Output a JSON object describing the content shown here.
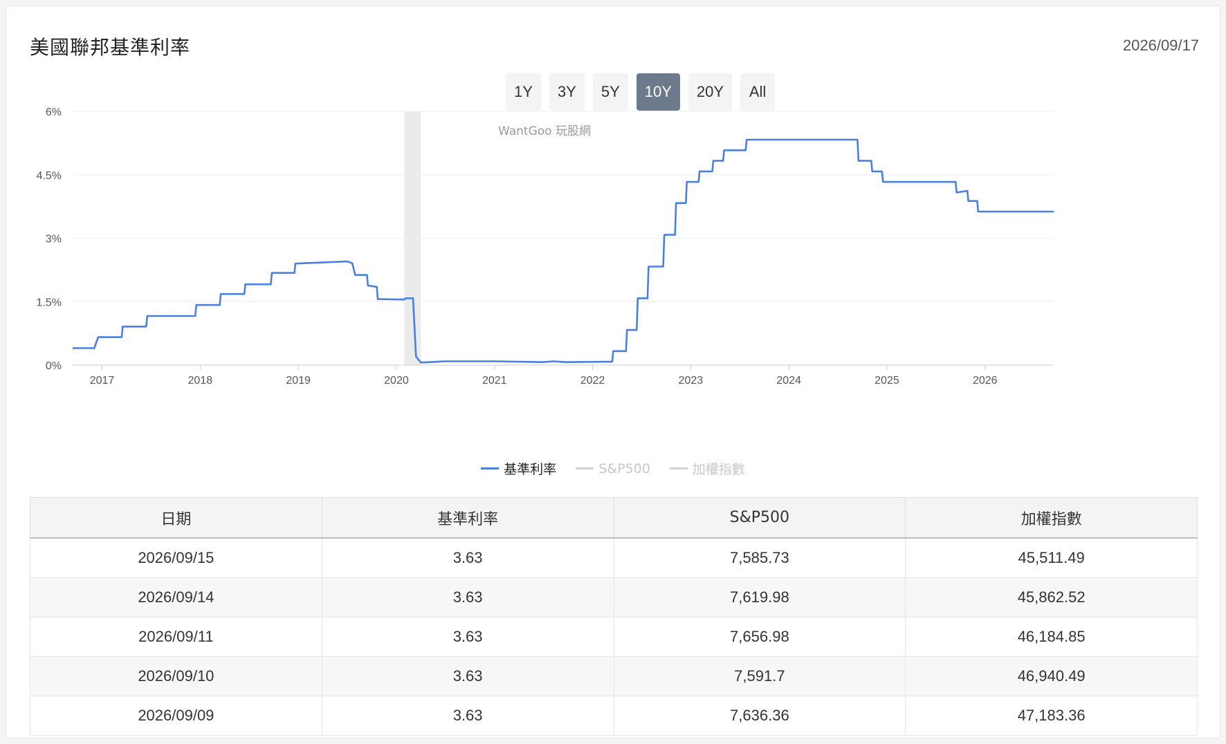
{
  "header": {
    "title": "美國聯邦基準利率",
    "date": "2026/09/17"
  },
  "range_buttons": [
    {
      "label": "1Y",
      "active": false
    },
    {
      "label": "3Y",
      "active": false
    },
    {
      "label": "5Y",
      "active": false
    },
    {
      "label": "10Y",
      "active": true
    },
    {
      "label": "20Y",
      "active": false
    },
    {
      "label": "All",
      "active": false
    }
  ],
  "colors": {
    "series": "#4a7fe0",
    "recession_band": "#ebebeb",
    "gridline": "#eeeeee",
    "legend_off": "#cccccc",
    "active_button": "#6c7a8c"
  },
  "chart_data": {
    "type": "line",
    "watermark": "WantGoo 玩股網",
    "y_ticks": [
      "0%",
      "1.5%",
      "3%",
      "4.5%",
      "6%"
    ],
    "ylim": [
      0,
      6
    ],
    "x_ticks": [
      "2017",
      "2018",
      "2019",
      "2020",
      "2021",
      "2022",
      "2023",
      "2024",
      "2025",
      "2026"
    ],
    "xlim": [
      2016.7,
      2026.7
    ],
    "recession_band": [
      2020.08,
      2020.25
    ],
    "legend": [
      {
        "name": "基準利率",
        "visible": true
      },
      {
        "name": "S&P500",
        "visible": false
      },
      {
        "name": "加權指數",
        "visible": false
      }
    ],
    "series": [
      {
        "name": "基準利率",
        "points": [
          [
            2016.7,
            0.4
          ],
          [
            2016.92,
            0.4
          ],
          [
            2016.96,
            0.66
          ],
          [
            2017.2,
            0.66
          ],
          [
            2017.21,
            0.91
          ],
          [
            2017.45,
            0.91
          ],
          [
            2017.46,
            1.16
          ],
          [
            2017.95,
            1.16
          ],
          [
            2017.96,
            1.42
          ],
          [
            2018.2,
            1.42
          ],
          [
            2018.21,
            1.68
          ],
          [
            2018.45,
            1.68
          ],
          [
            2018.46,
            1.91
          ],
          [
            2018.72,
            1.91
          ],
          [
            2018.73,
            2.18
          ],
          [
            2018.96,
            2.18
          ],
          [
            2018.97,
            2.4
          ],
          [
            2019.5,
            2.45
          ],
          [
            2019.55,
            2.41
          ],
          [
            2019.58,
            2.13
          ],
          [
            2019.7,
            2.13
          ],
          [
            2019.71,
            1.88
          ],
          [
            2019.8,
            1.85
          ],
          [
            2019.81,
            1.56
          ],
          [
            2020.08,
            1.55
          ],
          [
            2020.09,
            1.58
          ],
          [
            2020.17,
            1.58
          ],
          [
            2020.18,
            1.1
          ],
          [
            2020.2,
            0.2
          ],
          [
            2020.25,
            0.06
          ],
          [
            2020.5,
            0.09
          ],
          [
            2021.0,
            0.09
          ],
          [
            2021.5,
            0.07
          ],
          [
            2021.6,
            0.09
          ],
          [
            2021.72,
            0.07
          ],
          [
            2022.2,
            0.08
          ],
          [
            2022.21,
            0.33
          ],
          [
            2022.34,
            0.33
          ],
          [
            2022.35,
            0.83
          ],
          [
            2022.45,
            0.83
          ],
          [
            2022.46,
            1.58
          ],
          [
            2022.56,
            1.58
          ],
          [
            2022.57,
            2.33
          ],
          [
            2022.72,
            2.33
          ],
          [
            2022.73,
            3.08
          ],
          [
            2022.84,
            3.08
          ],
          [
            2022.85,
            3.83
          ],
          [
            2022.95,
            3.83
          ],
          [
            2022.96,
            4.33
          ],
          [
            2023.08,
            4.33
          ],
          [
            2023.09,
            4.58
          ],
          [
            2023.22,
            4.58
          ],
          [
            2023.23,
            4.83
          ],
          [
            2023.33,
            4.83
          ],
          [
            2023.34,
            5.08
          ],
          [
            2023.56,
            5.08
          ],
          [
            2023.57,
            5.33
          ],
          [
            2024.7,
            5.33
          ],
          [
            2024.71,
            4.83
          ],
          [
            2024.84,
            4.83
          ],
          [
            2024.85,
            4.58
          ],
          [
            2024.95,
            4.58
          ],
          [
            2024.96,
            4.33
          ],
          [
            2025.7,
            4.33
          ],
          [
            2025.71,
            4.08
          ],
          [
            2025.82,
            4.12
          ],
          [
            2025.83,
            3.88
          ],
          [
            2025.92,
            3.88
          ],
          [
            2025.93,
            3.63
          ],
          [
            2026.7,
            3.63
          ]
        ]
      }
    ]
  },
  "table": {
    "headers": [
      "日期",
      "基準利率",
      "S&P500",
      "加權指數"
    ],
    "rows": [
      [
        "2026/09/15",
        "3.63",
        "7,585.73",
        "45,511.49"
      ],
      [
        "2026/09/14",
        "3.63",
        "7,619.98",
        "45,862.52"
      ],
      [
        "2026/09/11",
        "3.63",
        "7,656.98",
        "46,184.85"
      ],
      [
        "2026/09/10",
        "3.63",
        "7,591.7",
        "46,940.49"
      ],
      [
        "2026/09/09",
        "3.63",
        "7,636.36",
        "47,183.36"
      ]
    ]
  }
}
